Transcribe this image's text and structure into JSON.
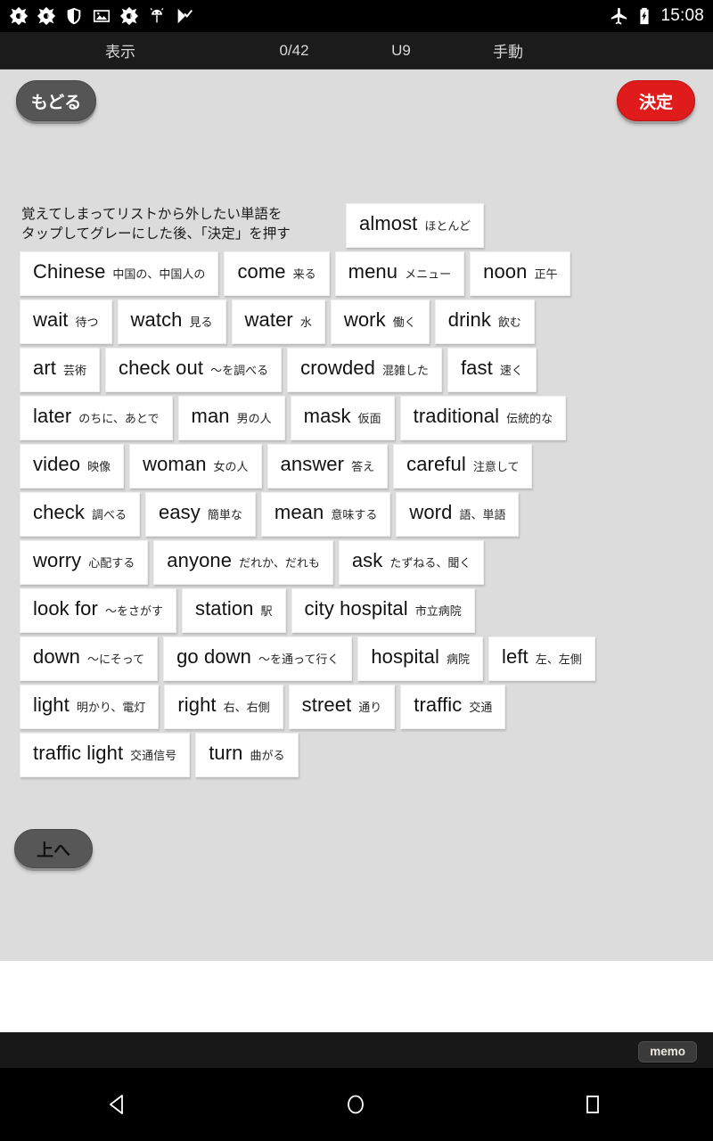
{
  "statusbar": {
    "icons": [
      "app-icon",
      "app-icon",
      "shield-icon",
      "image-icon",
      "app-icon",
      "android-icon",
      "checkmark-flag-icon"
    ],
    "airplane_icon": "airplane-mode-icon",
    "battery_icon": "battery-charging-icon",
    "clock": "15:08"
  },
  "appbar": {
    "display_label": "表示",
    "progress": "0/42",
    "unit": "U9",
    "mode": "手動"
  },
  "toolbar": {
    "back_label": "もどる",
    "decide_label": "決定"
  },
  "instruction": "覚えてしまってリストから外したい単語を\nタップしてグレーにした後、「決定」を押す",
  "up_button": {
    "label": "上へ"
  },
  "memo": {
    "label": "memo"
  },
  "navbar": {
    "back_icon": "nav-back-triangle-icon",
    "home_icon": "nav-home-circle-icon",
    "recents_icon": "nav-recents-square-icon"
  },
  "colors": {
    "panel_bg": "#dcdcdc",
    "card_bg": "#ffffff",
    "decide_red": "#e01b1b",
    "button_gray": "#555556",
    "statusbar_bg": "#000000",
    "appbar_bg": "#1b1b1b"
  },
  "word_rows": [
    [
      {
        "en": "almost",
        "jp": "ほとんど"
      }
    ],
    [
      {
        "en": "Chinese",
        "jp": "中国の、中国人の"
      },
      {
        "en": "come",
        "jp": "来る"
      },
      {
        "en": "menu",
        "jp": "メニュー"
      },
      {
        "en": "noon",
        "jp": "正午"
      }
    ],
    [
      {
        "en": "wait",
        "jp": "待つ"
      },
      {
        "en": "watch",
        "jp": "見る"
      },
      {
        "en": "water",
        "jp": "水"
      },
      {
        "en": "work",
        "jp": "働く"
      },
      {
        "en": "drink",
        "jp": "飲む"
      }
    ],
    [
      {
        "en": "art",
        "jp": "芸術"
      },
      {
        "en": "check out",
        "jp": "〜を調べる"
      },
      {
        "en": "crowded",
        "jp": "混雑した"
      },
      {
        "en": "fast",
        "jp": "速く"
      }
    ],
    [
      {
        "en": "later",
        "jp": "のちに、あとで"
      },
      {
        "en": "man",
        "jp": "男の人"
      },
      {
        "en": "mask",
        "jp": "仮面"
      },
      {
        "en": "traditional",
        "jp": "伝統的な"
      }
    ],
    [
      {
        "en": "video",
        "jp": "映像"
      },
      {
        "en": "woman",
        "jp": "女の人"
      },
      {
        "en": "answer",
        "jp": "答え"
      },
      {
        "en": "careful",
        "jp": "注意して"
      }
    ],
    [
      {
        "en": "check",
        "jp": "調べる"
      },
      {
        "en": "easy",
        "jp": "簡単な"
      },
      {
        "en": "mean",
        "jp": "意味する"
      },
      {
        "en": "word",
        "jp": "語、単語"
      }
    ],
    [
      {
        "en": "worry",
        "jp": "心配する"
      },
      {
        "en": "anyone",
        "jp": "だれか、だれも"
      },
      {
        "en": "ask",
        "jp": "たずねる、聞く"
      }
    ],
    [
      {
        "en": "look for",
        "jp": "〜をさがす"
      },
      {
        "en": "station",
        "jp": "駅"
      },
      {
        "en": "city hospital",
        "jp": "市立病院"
      }
    ],
    [
      {
        "en": "down",
        "jp": "〜にそって"
      },
      {
        "en": "go down",
        "jp": "〜を通って行く"
      },
      {
        "en": "hospital",
        "jp": "病院"
      },
      {
        "en": "left",
        "jp": "左、左側"
      }
    ],
    [
      {
        "en": "light",
        "jp": "明かり、電灯"
      },
      {
        "en": "right",
        "jp": "右、右側"
      },
      {
        "en": "street",
        "jp": "通り"
      },
      {
        "en": "traffic",
        "jp": "交通"
      }
    ],
    [
      {
        "en": "traffic light",
        "jp": "交通信号"
      },
      {
        "en": "turn",
        "jp": "曲がる"
      }
    ]
  ]
}
